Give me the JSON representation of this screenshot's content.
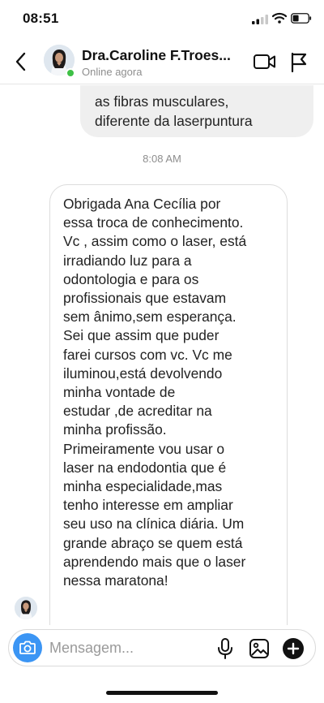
{
  "status_bar": {
    "time": "08:51"
  },
  "header": {
    "contact_name": "Dra.Caroline F.Troes...",
    "status": "Online agora"
  },
  "chat": {
    "sent_message": {
      "lines": [
        "as fibras musculares,",
        "diferente da laserpuntura"
      ]
    },
    "timestamp": "8:08 AM",
    "received_message": {
      "lines": [
        "Obrigada Ana Cecília por",
        "essa troca de conhecimento.",
        "Vc , assim como o laser, está",
        "irradiando luz para a",
        "odontologia e para os",
        "profissionais que estavam",
        "sem ânimo,sem esperança.",
        "Sei que assim que puder",
        "farei cursos com vc. Vc me",
        "iluminou,está devolvendo",
        "minha vontade de",
        "estudar ,de acreditar na",
        "minha profissão.",
        "Primeiramente vou usar o",
        "laser na  endodontia que é",
        "minha especialidade,mas",
        "tenho interesse em ampliar",
        "seu uso na clínica diária. Um",
        "grande abraço se quem está",
        "aprendendo mais que o laser",
        "nessa maratona!"
      ]
    }
  },
  "composer": {
    "placeholder": "Mensagem..."
  },
  "colors": {
    "camera_button": "#3b95f4",
    "online_dot": "#3ec046"
  },
  "icons": {
    "back": "chevron-left-icon",
    "video": "video-camera-icon",
    "flag": "flag-icon",
    "camera": "camera-icon",
    "mic": "microphone-icon",
    "gallery": "image-icon",
    "plus": "plus-icon"
  }
}
